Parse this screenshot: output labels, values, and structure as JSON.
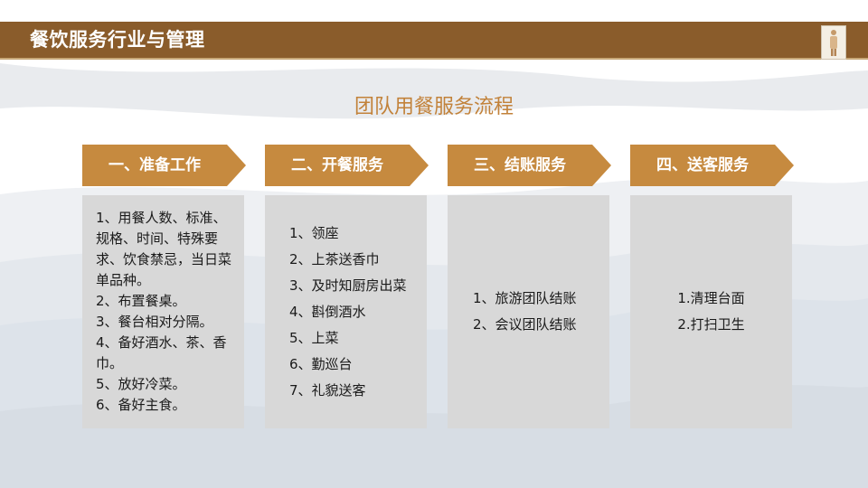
{
  "header": {
    "title": "餐饮服务行业与管理"
  },
  "slide": {
    "title": "团队用餐服务流程"
  },
  "colors": {
    "header_bg": "#8a5c2b",
    "step_header": "#c68a3f",
    "title_text": "#c2823a",
    "box_bg": "#d8d8d8"
  },
  "steps": [
    {
      "label": "一、准备工作",
      "items": [
        "1、用餐人数、标准、规格、时间、特殊要求、饮食禁忌，当日菜单品种。",
        "2、布置餐桌。",
        "3、餐台相对分隔。",
        "4、备好酒水、茶、香巾。",
        "5、放好冷菜。",
        "6、备好主食。"
      ]
    },
    {
      "label": "二、开餐服务",
      "items": [
        "1、领座",
        "2、上茶送香巾",
        "3、及时知厨房出菜",
        "4、斟倒酒水",
        "5、上菜",
        "6、勤巡台",
        "7、礼貌送客"
      ]
    },
    {
      "label": "三、结账服务",
      "items": [
        "1、旅游团队结账",
        "2、会议团队结账"
      ]
    },
    {
      "label": "四、送客服务",
      "items": [
        "1.清理台面",
        "2.打扫卫生"
      ]
    }
  ]
}
